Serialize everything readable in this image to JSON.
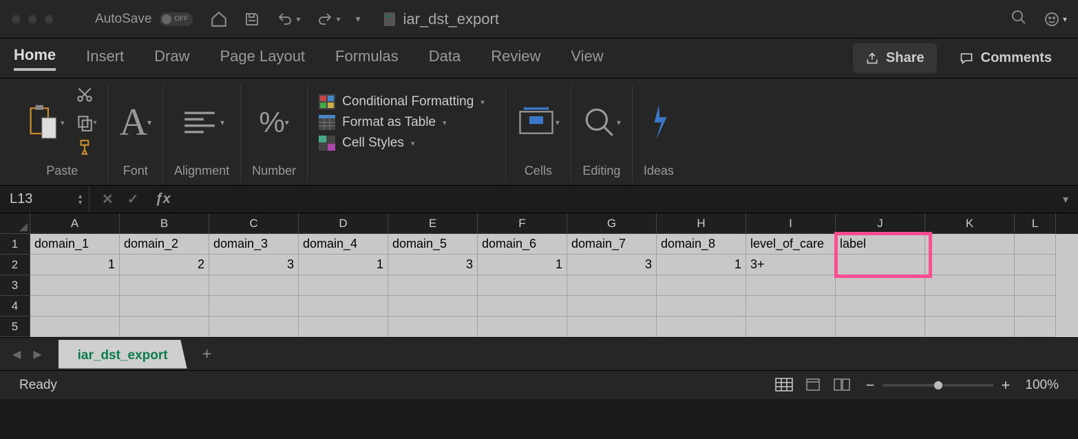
{
  "titlebar": {
    "autosave_label": "AutoSave",
    "autosave_state": "OFF",
    "doc_name": "iar_dst_export"
  },
  "tabs": {
    "items": [
      "Home",
      "Insert",
      "Draw",
      "Page Layout",
      "Formulas",
      "Data",
      "Review",
      "View"
    ],
    "active": "Home",
    "share": "Share",
    "comments": "Comments"
  },
  "ribbon": {
    "paste": "Paste",
    "font": "Font",
    "alignment": "Alignment",
    "number": "Number",
    "cond_fmt": "Conditional Formatting",
    "fmt_table": "Format as Table",
    "cell_styles": "Cell Styles",
    "cells": "Cells",
    "editing": "Editing",
    "ideas": "Ideas"
  },
  "formulabar": {
    "namebox": "L13"
  },
  "grid": {
    "columns": [
      "A",
      "B",
      "C",
      "D",
      "E",
      "F",
      "G",
      "H",
      "I",
      "J",
      "K",
      "L"
    ],
    "rows": [
      [
        "domain_1",
        "domain_2",
        "domain_3",
        "domain_4",
        "domain_5",
        "domain_6",
        "domain_7",
        "domain_8",
        "level_of_care",
        "label",
        "",
        ""
      ],
      [
        "1",
        "2",
        "3",
        "1",
        "3",
        "1",
        "3",
        "1",
        "3+",
        "",
        "",
        ""
      ],
      [
        "",
        "",
        "",
        "",
        "",
        "",
        "",
        "",
        "",
        "",
        "",
        ""
      ],
      [
        "",
        "",
        "",
        "",
        "",
        "",
        "",
        "",
        "",
        "",
        "",
        ""
      ],
      [
        "",
        "",
        "",
        "",
        "",
        "",
        "",
        "",
        "",
        "",
        "",
        ""
      ]
    ],
    "row_numbers": [
      "1",
      "2",
      "3",
      "4",
      "5"
    ],
    "numeric_cols": [
      0,
      1,
      2,
      3,
      4,
      5,
      6,
      7
    ],
    "highlight_col": 9
  },
  "sheet": {
    "name": "iar_dst_export"
  },
  "status": {
    "ready": "Ready",
    "zoom": "100%"
  }
}
